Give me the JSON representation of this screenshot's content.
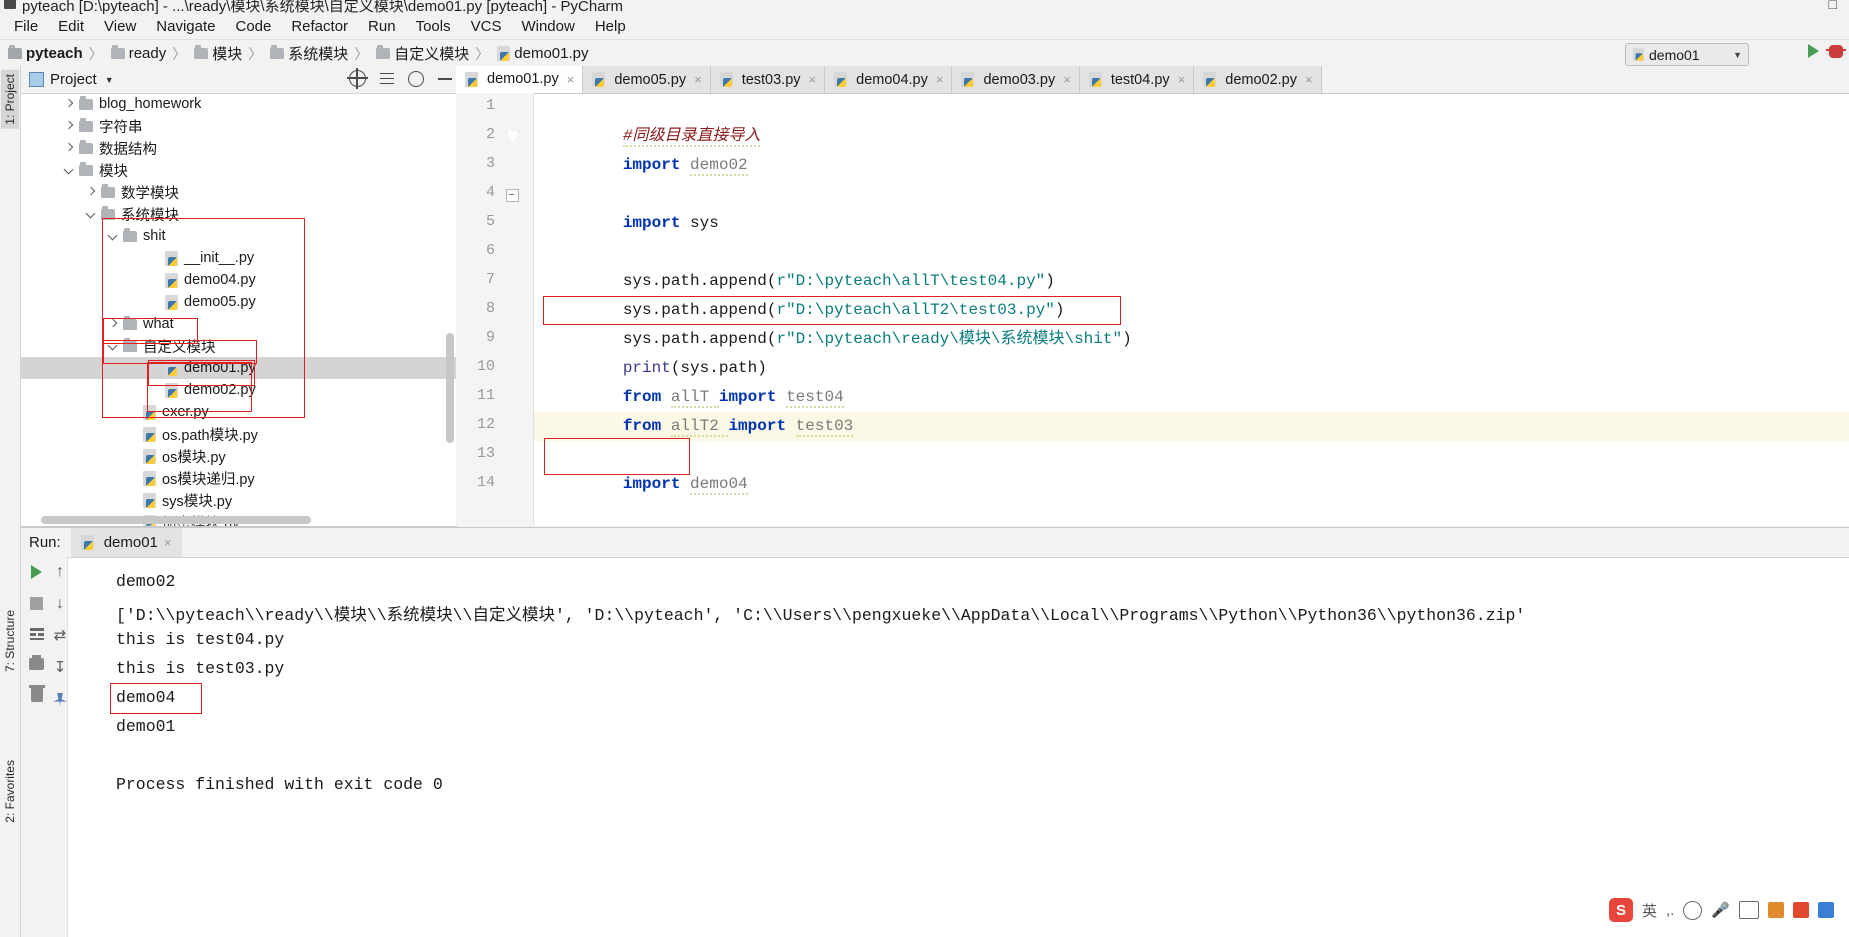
{
  "window": {
    "title": "pyteach [D:\\pyteach] - ...\\ready\\模块\\系统模块\\自定义模块\\demo01.py [pyteach] - PyCharm",
    "app_icon": "pycharm-icon",
    "controls": [
      "minimize",
      "maximize",
      "close"
    ]
  },
  "menu": {
    "items": [
      "File",
      "Edit",
      "View",
      "Navigate",
      "Code",
      "Refactor",
      "Run",
      "Tools",
      "VCS",
      "Window",
      "Help"
    ]
  },
  "breadcrumb": {
    "items": [
      {
        "label": "pyteach",
        "icon": "folder-icon",
        "bold": true
      },
      {
        "label": "ready",
        "icon": "folder-icon",
        "bold": false
      },
      {
        "label": "模块",
        "icon": "folder-icon",
        "bold": false
      },
      {
        "label": "系统模块",
        "icon": "folder-icon",
        "bold": false
      },
      {
        "label": "自定义模块",
        "icon": "folder-icon",
        "bold": false
      },
      {
        "label": "demo01.py",
        "icon": "python-file-icon",
        "bold": false
      }
    ],
    "separator": "〉"
  },
  "toolbar": {
    "run_config": "demo01",
    "run_config_caret": "▼",
    "run_button": "run-button",
    "debug_button": "debug-button"
  },
  "left_strip": {
    "project_tab": "1: Project",
    "structure_tab": "7: Structure",
    "favorites_tab": "2: Favorites"
  },
  "project_panel": {
    "title": "Project",
    "caret": "▼",
    "tree": [
      {
        "label": "blog_homework",
        "indent": 1,
        "type": "folder",
        "arrow": "right",
        "selected": false
      },
      {
        "label": "字符串",
        "indent": 1,
        "type": "folder",
        "arrow": "right",
        "selected": false
      },
      {
        "label": "数据结构",
        "indent": 1,
        "type": "folder",
        "arrow": "right",
        "selected": false
      },
      {
        "label": "模块",
        "indent": 1,
        "type": "folder",
        "arrow": "down",
        "selected": false
      },
      {
        "label": "数学模块",
        "indent": 2,
        "type": "folder",
        "arrow": "right",
        "selected": false
      },
      {
        "label": "系统模块",
        "indent": 2,
        "type": "folder",
        "arrow": "down",
        "selected": false
      },
      {
        "label": "shit",
        "indent": 3,
        "type": "folder",
        "arrow": "down",
        "selected": false
      },
      {
        "label": "__init__.py",
        "indent": 5,
        "type": "python",
        "arrow": "none",
        "selected": false
      },
      {
        "label": "demo04.py",
        "indent": 5,
        "type": "python",
        "arrow": "none",
        "selected": false
      },
      {
        "label": "demo05.py",
        "indent": 5,
        "type": "python",
        "arrow": "none",
        "selected": false
      },
      {
        "label": "what",
        "indent": 3,
        "type": "folder",
        "arrow": "right",
        "selected": false
      },
      {
        "label": "自定义模块",
        "indent": 3,
        "type": "folder",
        "arrow": "down",
        "selected": false
      },
      {
        "label": "demo01.py",
        "indent": 5,
        "type": "python",
        "arrow": "none",
        "selected": true
      },
      {
        "label": "demo02.py",
        "indent": 5,
        "type": "python",
        "arrow": "none",
        "selected": false
      },
      {
        "label": "exer.py",
        "indent": 4,
        "type": "python",
        "arrow": "none",
        "selected": false
      },
      {
        "label": "os.path模块.py",
        "indent": 4,
        "type": "python",
        "arrow": "none",
        "selected": false
      },
      {
        "label": "os模块.py",
        "indent": 4,
        "type": "python",
        "arrow": "none",
        "selected": false
      },
      {
        "label": "os模块递归.py",
        "indent": 4,
        "type": "python",
        "arrow": "none",
        "selected": false
      },
      {
        "label": "sys模块.py",
        "indent": 4,
        "type": "python",
        "arrow": "none",
        "selected": false
      },
      {
        "label": "加密模块.py",
        "indent": 4,
        "type": "python",
        "arrow": "none",
        "selected": false
      }
    ]
  },
  "editor": {
    "tabs": [
      {
        "label": "demo01.py",
        "active": true
      },
      {
        "label": "demo05.py",
        "active": false
      },
      {
        "label": "test03.py",
        "active": false
      },
      {
        "label": "demo04.py",
        "active": false
      },
      {
        "label": "demo03.py",
        "active": false
      },
      {
        "label": "test04.py",
        "active": false
      },
      {
        "label": "demo02.py",
        "active": false
      }
    ],
    "close_glyph": "×",
    "line_numbers": [
      "1",
      "2",
      "3",
      "4",
      "5",
      "6",
      "7",
      "8",
      "9",
      "10",
      "11",
      "12",
      "13",
      "14"
    ],
    "highlighted_line": 12,
    "lines": [
      {
        "n": 1,
        "tokens": [
          {
            "t": "#同级目录直接导入",
            "c": "comment"
          }
        ]
      },
      {
        "n": 2,
        "tokens": [
          {
            "t": "import ",
            "c": "keyword"
          },
          {
            "t": "demo02",
            "c": "gray-underlined"
          }
        ]
      },
      {
        "n": 3,
        "tokens": []
      },
      {
        "n": 4,
        "tokens": [
          {
            "t": "import ",
            "c": "keyword"
          },
          {
            "t": "sys",
            "c": "plain"
          }
        ]
      },
      {
        "n": 5,
        "tokens": []
      },
      {
        "n": 6,
        "tokens": [
          {
            "t": "sys.path.append(",
            "c": "plain"
          },
          {
            "t": "r\"D:\\pyteach\\allT\\test04.py\"",
            "c": "string"
          },
          {
            "t": ")",
            "c": "plain"
          }
        ]
      },
      {
        "n": 7,
        "tokens": [
          {
            "t": "sys.path.append(",
            "c": "plain"
          },
          {
            "t": "r\"D:\\pyteach\\allT2\\test03.py\"",
            "c": "string"
          },
          {
            "t": ")",
            "c": "plain"
          }
        ]
      },
      {
        "n": 8,
        "tokens": [
          {
            "t": "sys.path.append(",
            "c": "plain"
          },
          {
            "t": "r\"D:\\pyteach\\ready\\模块\\系统模块\\shit\"",
            "c": "string"
          },
          {
            "t": ")",
            "c": "plain"
          }
        ]
      },
      {
        "n": 9,
        "tokens": [
          {
            "t": "print",
            "c": "func"
          },
          {
            "t": "(sys.path)",
            "c": "plain"
          }
        ]
      },
      {
        "n": 10,
        "tokens": [
          {
            "t": "from ",
            "c": "keyword"
          },
          {
            "t": "allT ",
            "c": "gray-underlined"
          },
          {
            "t": "import ",
            "c": "keyword"
          },
          {
            "t": "test04",
            "c": "gray-underlined"
          }
        ]
      },
      {
        "n": 11,
        "tokens": [
          {
            "t": "from ",
            "c": "keyword"
          },
          {
            "t": "allT2 ",
            "c": "gray-underlined"
          },
          {
            "t": "import ",
            "c": "keyword"
          },
          {
            "t": "test03",
            "c": "gray-underlined"
          }
        ]
      },
      {
        "n": 12,
        "tokens": []
      },
      {
        "n": 13,
        "tokens": [
          {
            "t": "import ",
            "c": "keyword"
          },
          {
            "t": "demo04",
            "c": "gray-underlined"
          }
        ]
      },
      {
        "n": 14,
        "tokens": []
      }
    ]
  },
  "annotations": {
    "boxes": [
      {
        "name": "shit-folder-highlight"
      },
      {
        "name": "demo04-demo05-highlight"
      },
      {
        "name": "custom-module-folder-highlight"
      },
      {
        "name": "demo01-file-highlight"
      },
      {
        "name": "tree-group-outline"
      },
      {
        "name": "line8-sys-path-append-highlight"
      },
      {
        "name": "line13-import-demo04-highlight"
      },
      {
        "name": "console-demo04-highlight"
      }
    ]
  },
  "run_panel": {
    "label": "Run:",
    "tab": "demo01",
    "close_glyph": "×",
    "toolbar_icons": [
      "rerun-icon",
      "up-arrow-icon",
      "stop-icon",
      "down-arrow-icon",
      "print-grid-icon",
      "soft-wrap-icon",
      "scroll-to-end-icon",
      "print-icon",
      "pin-icon",
      "clear-all-icon"
    ],
    "console_lines": [
      "demo02",
      "['D:\\\\pyteach\\\\ready\\\\模块\\\\系统模块\\\\自定义模块', 'D:\\\\pyteach', 'C:\\\\Users\\\\pengxueke\\\\AppData\\\\Local\\\\Programs\\\\Python\\\\Python36\\\\python36.zip'",
      "this is test04.py",
      "this is test03.py",
      "demo04",
      "demo01",
      "",
      "Process finished with exit code 0"
    ]
  },
  "ime_bar": {
    "logo": "S",
    "mode": "英",
    "items": [
      "punctuation-icon",
      "emoji-icon",
      "mic-icon",
      "keyboard-icon",
      "screenshot-icon",
      "toolbox-icon",
      "apps-icon"
    ]
  },
  "colors": {
    "accent_red": "#e02020",
    "string_teal": "#0a7c7c",
    "keyword_blue": "#0033b3",
    "comment_red": "#8c1a1a",
    "selection_gray": "#d4d4d4",
    "highlight_yellow": "#fcf8e6"
  }
}
